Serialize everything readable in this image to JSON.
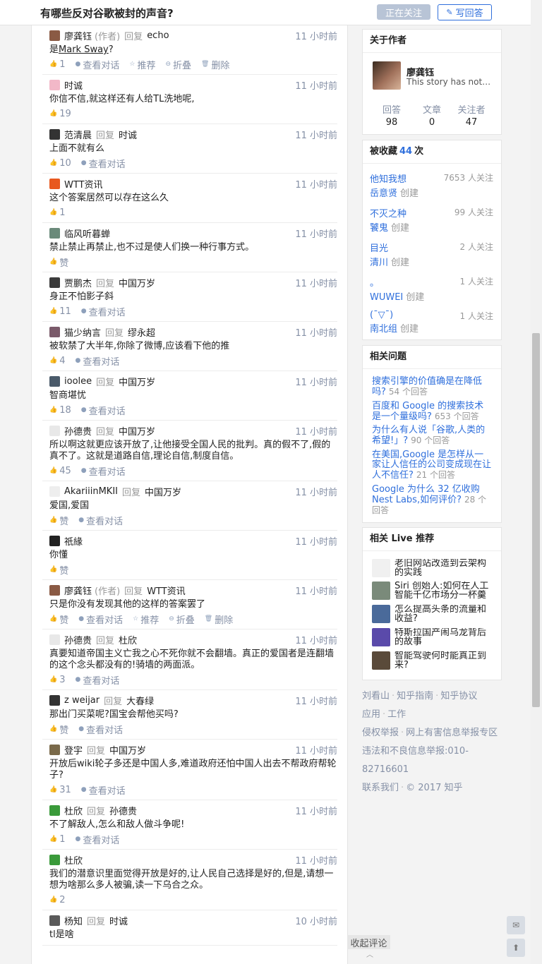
{
  "header": {
    "question_title": "有哪些反对谷歌被封的声音?",
    "follow_label": "正在关注",
    "write_label": "写回答",
    "write_icon": "pencil-icon"
  },
  "comments": [
    {
      "author": "廖龚钰",
      "tag": "(作者)",
      "reply_label": "回复",
      "reply_to": "echo",
      "time": "11 小时前",
      "text_before": "是",
      "link": "Mark Sway",
      "text_after": "?",
      "avatar_color": "#8a5a44",
      "actions": [
        {
          "icon": "thumb-up-icon",
          "label": "1"
        },
        {
          "icon": "chat-icon",
          "label": "查看对话"
        },
        {
          "icon": "star-icon",
          "label": "推荐"
        },
        {
          "icon": "fold-icon",
          "label": "折叠"
        },
        {
          "icon": "trash-icon",
          "label": "删除"
        }
      ]
    },
    {
      "author": "时诚",
      "time": "11 小时前",
      "text": "你信不信,就这样还有人给TL洗地呢,",
      "avatar_color": "#f2b8c8",
      "actions": [
        {
          "icon": "thumb-up-icon",
          "label": "19"
        }
      ]
    },
    {
      "author": "范清晨",
      "reply_label": "回复",
      "reply_to": "时诚",
      "time": "11 小时前",
      "text": "上面不就有么",
      "avatar_color": "#333333",
      "actions": [
        {
          "icon": "thumb-up-icon",
          "label": "10"
        },
        {
          "icon": "chat-icon",
          "label": "查看对话"
        }
      ]
    },
    {
      "author": "WTT资讯",
      "time": "11 小时前",
      "text": "这个答案居然可以存在这么久",
      "avatar_color": "#e8581f",
      "actions": [
        {
          "icon": "thumb-up-icon",
          "label": "1"
        }
      ]
    },
    {
      "author": "临风听暮蝉",
      "time": "11 小时前",
      "text": "禁止禁止再禁止,也不过是使人们换一种行事方式。",
      "avatar_color": "#6a8a7a",
      "actions": [
        {
          "icon": "thumb-up-icon",
          "label": "赞"
        }
      ]
    },
    {
      "author": "贾鹏杰",
      "reply_label": "回复",
      "reply_to": "中国万岁",
      "time": "11 小时前",
      "text": "身正不怕影子斜",
      "avatar_color": "#3b3b3b",
      "actions": [
        {
          "icon": "thumb-up-icon",
          "label": "11"
        },
        {
          "icon": "chat-icon",
          "label": "查看对话"
        }
      ]
    },
    {
      "author": "猫少纳言",
      "reply_label": "回复",
      "reply_to": "缪永超",
      "time": "11 小时前",
      "text": "被软禁了大半年,你除了微博,应该看下他的推",
      "avatar_color": "#7a5a6a",
      "actions": [
        {
          "icon": "thumb-up-icon",
          "label": "4"
        },
        {
          "icon": "chat-icon",
          "label": "查看对话"
        }
      ]
    },
    {
      "author": "ioolee",
      "reply_label": "回复",
      "reply_to": "中国万岁",
      "time": "11 小时前",
      "text": "智商堪忧",
      "avatar_color": "#4a5a6a",
      "actions": [
        {
          "icon": "thumb-up-icon",
          "label": "18"
        },
        {
          "icon": "chat-icon",
          "label": "查看对话"
        }
      ]
    },
    {
      "author": "孙德贵",
      "reply_label": "回复",
      "reply_to": "中国万岁",
      "time": "11 小时前",
      "text": "所以啊这就更应该开放了,让他接受全国人民的批判。真的假不了,假的真不了。这就是道路自信,理论自信,制度自信。",
      "avatar_color": "#e8e8e8",
      "actions": [
        {
          "icon": "thumb-up-icon",
          "label": "45"
        },
        {
          "icon": "chat-icon",
          "label": "查看对话"
        }
      ]
    },
    {
      "author": "AkariiinMKII",
      "reply_label": "回复",
      "reply_to": "中国万岁",
      "time": "11 小时前",
      "text": "爱国,爱国",
      "avatar_color": "#eeeeee",
      "actions": [
        {
          "icon": "thumb-up-icon",
          "label": "赞"
        },
        {
          "icon": "chat-icon",
          "label": "查看对话"
        }
      ]
    },
    {
      "author": "祇緣",
      "time": "11 小时前",
      "text": "你懂",
      "avatar_color": "#222222",
      "actions": [
        {
          "icon": "thumb-up-icon",
          "label": "赞"
        }
      ]
    },
    {
      "author": "廖龚钰",
      "tag": "(作者)",
      "reply_label": "回复",
      "reply_to": "WTT资讯",
      "time": "11 小时前",
      "text": "只是你没有发现其他的这样的答案罢了",
      "avatar_color": "#8a5a44",
      "actions": [
        {
          "icon": "thumb-up-icon",
          "label": "赞"
        },
        {
          "icon": "chat-icon",
          "label": "查看对话"
        },
        {
          "icon": "star-icon",
          "label": "推荐"
        },
        {
          "icon": "fold-icon",
          "label": "折叠"
        },
        {
          "icon": "trash-icon",
          "label": "删除"
        }
      ]
    },
    {
      "author": "孙德贵",
      "reply_label": "回复",
      "reply_to": "杜欣",
      "time": "11 小时前",
      "text": "真要知道帝国主义亡我之心不死你就不会翻墙。真正的爱国者是连翻墙的这个念头都没有的!骑墙的两面派。",
      "avatar_color": "#e8e8e8",
      "actions": [
        {
          "icon": "thumb-up-icon",
          "label": "3"
        },
        {
          "icon": "chat-icon",
          "label": "查看对话"
        }
      ]
    },
    {
      "author": "z weijar",
      "reply_label": "回复",
      "reply_to": "大春绿",
      "time": "11 小时前",
      "text": "那出门买菜呢?国宝会帮他买吗?",
      "avatar_color": "#333333",
      "actions": [
        {
          "icon": "thumb-up-icon",
          "label": "赞"
        },
        {
          "icon": "chat-icon",
          "label": "查看对话"
        }
      ]
    },
    {
      "author": "登宇",
      "reply_label": "回复",
      "reply_to": "中国万岁",
      "time": "11 小时前",
      "text": "开放后wiki轮子多还是中国人多,难道政府还怕中国人出去不帮政府帮轮子?",
      "avatar_color": "#7a6a4a",
      "actions": [
        {
          "icon": "thumb-up-icon",
          "label": "31"
        },
        {
          "icon": "chat-icon",
          "label": "查看对话"
        }
      ]
    },
    {
      "author": "杜欣",
      "reply_label": "回复",
      "reply_to": "孙德贵",
      "time": "11 小时前",
      "text": "不了解敌人,怎么和敌人做斗争呢!",
      "avatar_color": "#3a9a3a",
      "actions": [
        {
          "icon": "thumb-up-icon",
          "label": "1"
        },
        {
          "icon": "chat-icon",
          "label": "查看对话"
        }
      ]
    },
    {
      "author": "杜欣",
      "time": "11 小时前",
      "text": "我们的潜意识里面觉得开放是好的,让人民自己选择是好的,但是,请想一想为啥那么多人被骗,读一下乌合之众。",
      "avatar_color": "#3a9a3a",
      "actions": [
        {
          "icon": "thumb-up-icon",
          "label": "2"
        }
      ]
    },
    {
      "author": "杨知",
      "reply_label": "回复",
      "reply_to": "时诚",
      "time": "10 小时前",
      "text": "tl是啥",
      "avatar_color": "#5a5a5a",
      "actions": []
    }
  ],
  "collapse_label": "收起评论",
  "about": {
    "title": "关于作者",
    "name": "廖龚钰",
    "bio": "This story has not ended",
    "stats": [
      {
        "label": "回答",
        "value": "98"
      },
      {
        "label": "文章",
        "value": "0"
      },
      {
        "label": "关注者",
        "value": "47"
      }
    ]
  },
  "collected": {
    "title_prefix": "被收藏",
    "count": "44",
    "title_suffix": "次",
    "items": [
      {
        "name": "他知我想",
        "creator": "岳意贤",
        "role": "创建",
        "followers": "7653 人关注"
      },
      {
        "name": "不灭之种",
        "creator": "饕鬼",
        "role": "创建",
        "followers": "99 人关注"
      },
      {
        "name": "目光",
        "creator": "清川",
        "role": "创建",
        "followers": "2 人关注"
      },
      {
        "name": "。",
        "creator": "WUWEI",
        "role": "创建",
        "followers": "1 人关注"
      },
      {
        "name": "(¯▽¯)",
        "creator": "南北组",
        "role": "创建",
        "followers": "1 人关注"
      }
    ]
  },
  "related": {
    "title": "相关问题",
    "items": [
      {
        "q": "搜索引擎的价值确是在降低吗?",
        "count": "54 个回答"
      },
      {
        "q": "百度和 Google 的搜索技术是一个量级吗?",
        "count": "653 个回答"
      },
      {
        "q": "为什么有人说「谷歌,人类的希望!」?",
        "count": "90 个回答"
      },
      {
        "q": "在美国,Google 是怎样从一家让人信任的公司变成现在让人不信任?",
        "count": "21 个回答"
      },
      {
        "q": "Google 为什么 32 亿收购 Nest Labs,如何评价?",
        "count": "28 个回答"
      }
    ]
  },
  "live": {
    "title": "相关 Live 推荐",
    "items": [
      {
        "title": "老旧网站改造到云架构的实践",
        "color": "#f0f0f0"
      },
      {
        "title": "Siri 创始人:如何在人工智能千亿市场分一杯羹",
        "color": "#7a8a7a"
      },
      {
        "title": "怎么提高头条的流量和收益?",
        "color": "#4a6a9a"
      },
      {
        "title": "特斯拉国产闹乌龙背后的故事",
        "color": "#5a4aaa"
      },
      {
        "title": "智能驾驶何时能真正到来?",
        "color": "#5a4a3a"
      }
    ]
  },
  "footer": {
    "links": [
      "刘看山",
      "知乎指南",
      "知乎协议",
      "应用",
      "工作",
      "侵权举报",
      "网上有害信息举报专区",
      "违法和不良信息举报:010-82716601",
      "联系我们",
      "© 2017 知乎"
    ]
  },
  "float_buttons": [
    "mail-icon",
    "arrow-up-icon"
  ]
}
